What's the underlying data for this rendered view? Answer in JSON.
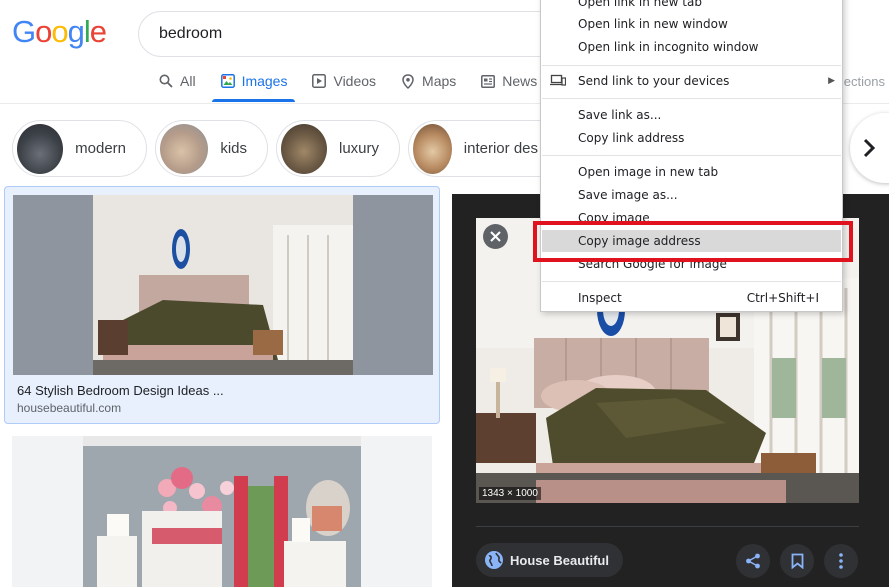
{
  "logo": {
    "letters": [
      "G",
      "o",
      "o",
      "g",
      "l",
      "e"
    ]
  },
  "search": {
    "query": "bedroom"
  },
  "tabs": [
    {
      "label": "All",
      "icon": "search-icon"
    },
    {
      "label": "Images",
      "icon": "image-icon",
      "active": true
    },
    {
      "label": "Videos",
      "icon": "play-icon"
    },
    {
      "label": "Maps",
      "icon": "map-pin-icon"
    },
    {
      "label": "News",
      "icon": "news-icon"
    }
  ],
  "collections_label": "llections",
  "chips": [
    "modern",
    "kids",
    "luxury",
    "interior des"
  ],
  "results": [
    {
      "title": "64 Stylish Bedroom Design Ideas ...",
      "source": "housebeautiful.com"
    }
  ],
  "preview": {
    "size_label": "1343 × 1000",
    "source_label": "House Beautiful"
  },
  "context_menu": {
    "items": [
      {
        "label": "Open link in new tab"
      },
      {
        "label": "Open link in new window"
      },
      {
        "label": "Open link in incognito window"
      },
      {
        "label": "Send link to your devices",
        "icon": "devices-icon",
        "submenu": true
      },
      {
        "label": "Save link as..."
      },
      {
        "label": "Copy link address"
      },
      {
        "label": "Open image in new tab"
      },
      {
        "label": "Save image as..."
      },
      {
        "label": "Copy image"
      },
      {
        "label": "Copy image address",
        "highlighted": true
      },
      {
        "label": "Search Google for image"
      },
      {
        "label": "Inspect",
        "shortcut": "Ctrl+Shift+I"
      }
    ]
  },
  "colors": {
    "google_blue": "#4285f4",
    "google_red": "#ea4335",
    "google_yellow": "#fbbc05",
    "google_green": "#34a853",
    "accent": "#1a73e8",
    "highlight_box": "#e0121e"
  }
}
